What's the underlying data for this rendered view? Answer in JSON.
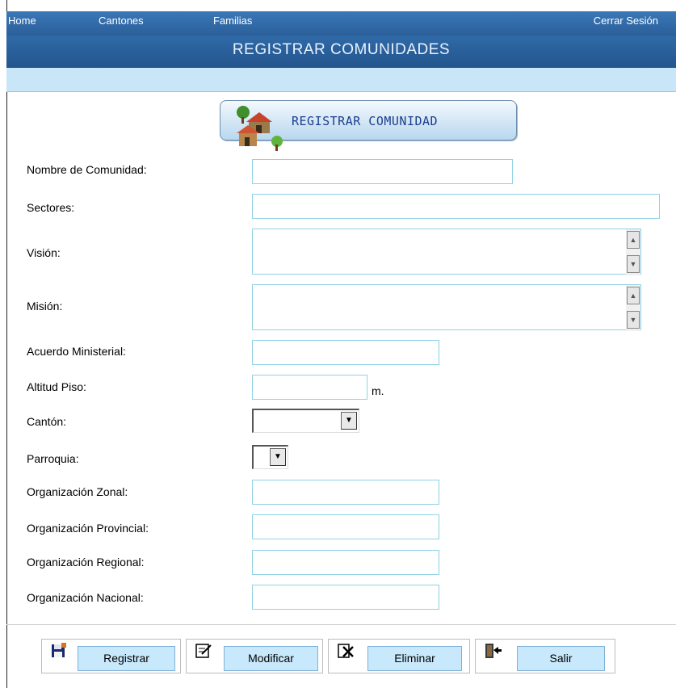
{
  "nav": {
    "home": "Home",
    "cantones": "Cantones",
    "familias": "Familias",
    "logout": "Cerrar Sesión"
  },
  "page": {
    "title": "REGISTRAR COMUNIDADES",
    "form_header": "REGISTRAR COMUNIDAD",
    "header_icon": "houses-trees-icon"
  },
  "form": {
    "nombre": {
      "label": "Nombre de Comunidad:",
      "value": ""
    },
    "sectores": {
      "label": "Sectores:",
      "value": ""
    },
    "vision": {
      "label": "Visión:",
      "value": ""
    },
    "mision": {
      "label": "Misión:",
      "value": ""
    },
    "acuerdo": {
      "label": "Acuerdo Ministerial:",
      "value": ""
    },
    "altitud": {
      "label": "Altitud Piso:",
      "value": "",
      "unit": "m."
    },
    "canton": {
      "label": "Cantón:",
      "selected": ""
    },
    "parroquia": {
      "label": "Parroquia:",
      "selected": ""
    },
    "org_zonal": {
      "label": "Organización Zonal:",
      "value": ""
    },
    "org_provincial": {
      "label": "Organización Provincial:",
      "value": ""
    },
    "org_regional": {
      "label": "Organización Regional:",
      "value": ""
    },
    "org_nacional": {
      "label": "Organización Nacional:",
      "value": ""
    }
  },
  "actions": {
    "registrar": {
      "label": "Registrar",
      "icon": "save-icon"
    },
    "modificar": {
      "label": "Modificar",
      "icon": "edit-icon"
    },
    "eliminar": {
      "label": "Eliminar",
      "icon": "delete-icon"
    },
    "salir": {
      "label": "Salir",
      "icon": "exit-icon"
    }
  },
  "colors": {
    "nav_bg": "#3a78b8",
    "title_bg": "#2f6aa7",
    "subbar_bg": "#c9e6f8",
    "input_border": "#8fd2e6",
    "button_bg": "#c8e8fb"
  }
}
